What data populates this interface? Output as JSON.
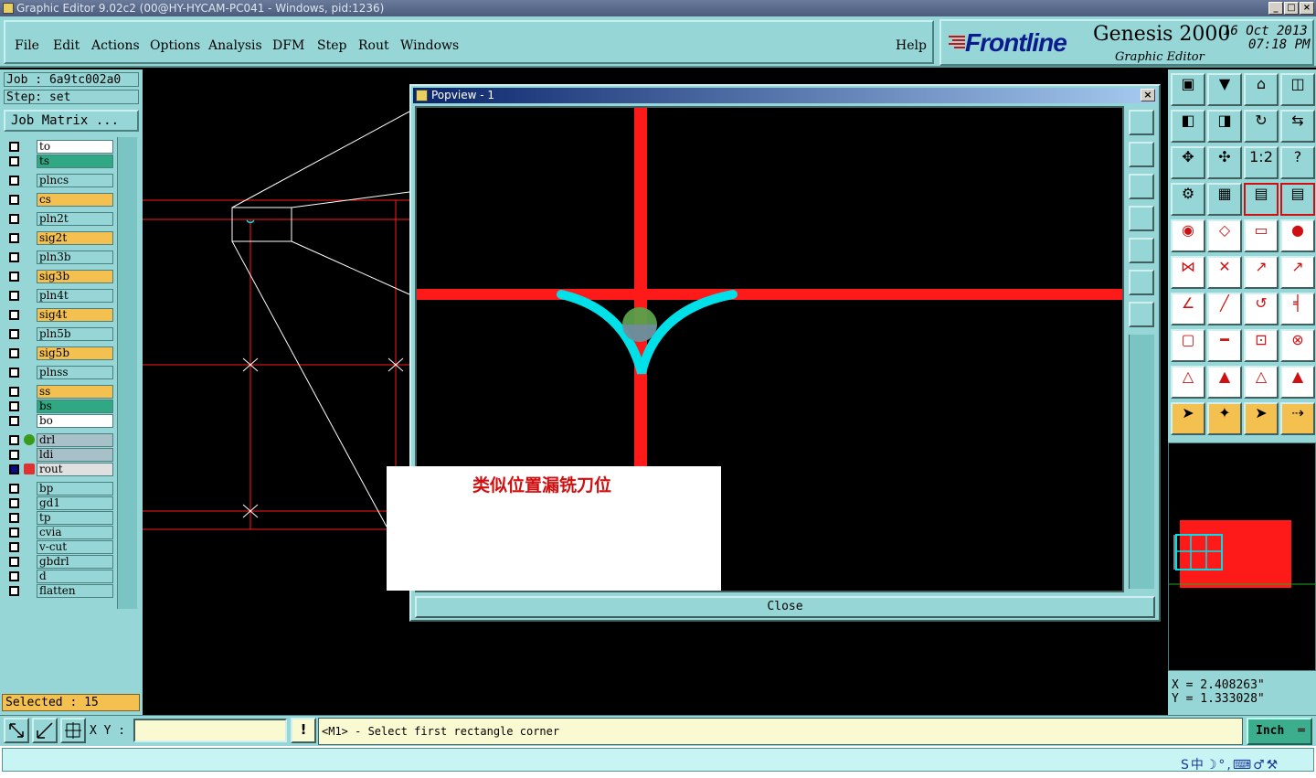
{
  "window": {
    "title": "Graphic Editor 9.02c2 (00@HY-HYCAM-PC041 - Windows, pid:1236)",
    "min": "_",
    "max": "□",
    "close": "×"
  },
  "menu": [
    "File",
    "Edit",
    "Actions",
    "Options",
    "Analysis",
    "DFM",
    "Step",
    "Rout",
    "Windows"
  ],
  "help": "Help",
  "brand": {
    "logo": "Frontline",
    "product": "Genesis 2000",
    "subtitle": "Graphic Editor",
    "date": "16 Oct 2013",
    "time": "07:18 PM"
  },
  "job": {
    "job_line": "Job : 6a9tc002a0",
    "step_line": "Step: set",
    "matrix_button": "Job Matrix ..."
  },
  "layers": [
    {
      "name": "to",
      "color": "#ffffff"
    },
    {
      "name": "ts",
      "color": "#2fa883"
    },
    {
      "name": "plncs",
      "color": "#96d6d6"
    },
    {
      "name": "cs",
      "color": "#f4c050"
    },
    {
      "name": "pln2t",
      "color": "#96d6d6"
    },
    {
      "name": "sig2t",
      "color": "#f4c050"
    },
    {
      "name": "pln3b",
      "color": "#96d6d6"
    },
    {
      "name": "sig3b",
      "color": "#f4c050"
    },
    {
      "name": "pln4t",
      "color": "#96d6d6"
    },
    {
      "name": "sig4t",
      "color": "#f4c050"
    },
    {
      "name": "pln5b",
      "color": "#96d6d6"
    },
    {
      "name": "sig5b",
      "color": "#f4c050"
    },
    {
      "name": "plnss",
      "color": "#96d6d6"
    },
    {
      "name": "ss",
      "color": "#f4c050"
    },
    {
      "name": "bs",
      "color": "#2fa883"
    },
    {
      "name": "bo",
      "color": "#ffffff"
    },
    {
      "name": "drl",
      "color": "#a8c0c8",
      "indicator": "green"
    },
    {
      "name": "ldi",
      "color": "#a8c0c8"
    },
    {
      "name": "rout",
      "color": "#e0e0e0",
      "indicator": "work"
    },
    {
      "name": "bp",
      "color": "#96d6d6"
    },
    {
      "name": "gd1",
      "color": "#96d6d6"
    },
    {
      "name": "tp",
      "color": "#96d6d6"
    },
    {
      "name": "cvia",
      "color": "#96d6d6"
    },
    {
      "name": "v-cut",
      "color": "#96d6d6"
    },
    {
      "name": "gbdrl",
      "color": "#96d6d6"
    },
    {
      "name": "d",
      "color": "#96d6d6"
    },
    {
      "name": "flatten",
      "color": "#96d6d6"
    }
  ],
  "selected": "Selected : 15",
  "popview": {
    "title": "Popview - 1",
    "close_button": "Close"
  },
  "annotation": "类似位置漏铣刀位",
  "coords": {
    "x": "X = 2.408263\"",
    "y": "Y = 1.333028\""
  },
  "status": {
    "xy_label": "X Y :",
    "xy_value": "",
    "message": "<M1> - Select first rectangle corner",
    "unit": "Inch",
    "warn": "!"
  },
  "ime": "S中☽°,⌨♂⚒",
  "colors": {
    "panel": "#96d6d6",
    "red": "#ff1a1a",
    "cyan": "#00e0e8",
    "orange": "#f4c050"
  }
}
